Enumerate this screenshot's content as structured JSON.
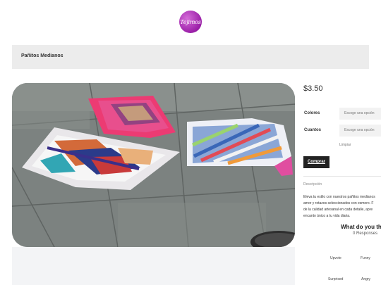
{
  "header": {
    "logo_text": "Tejimos"
  },
  "product": {
    "title": "Pañitos Medianos",
    "price": "$3.50",
    "options": [
      {
        "label": "Colores",
        "placeholder": "Escoge una opción"
      },
      {
        "label": "Cuantos",
        "placeholder": "Escoge una opción"
      }
    ],
    "clear_label": "Limpiar",
    "buy_label": "Comprar",
    "tab_label": "Descripción",
    "description_lines": [
      "Eleva tu estilo con nuestros pañitos medianos",
      "amor y retazos seleccionados con esmero. F",
      "de la calidad artesanal en cada detalle, apre",
      "encanto único a tu vida diaria."
    ]
  },
  "poll": {
    "title": "What do you thi",
    "responses": "0 Responses",
    "reactions": [
      "Upvote",
      "Funny",
      "Surprised",
      "Angry"
    ]
  },
  "colors": {
    "logo": "#9b1fa8",
    "button": "#222222",
    "title_bar": "#ececec"
  }
}
